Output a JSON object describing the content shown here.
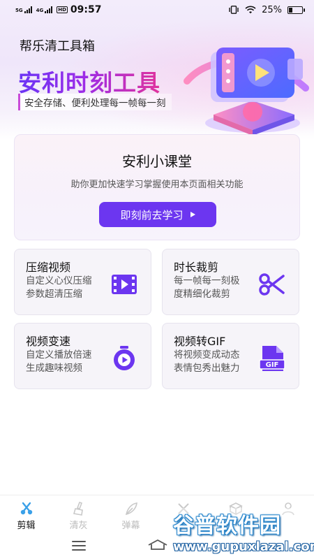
{
  "status_bar": {
    "signal1_label": "5G",
    "signal2_label": "4G",
    "hd_label": "HD",
    "time": "09:57",
    "battery": "25%",
    "battery_level": 0.25
  },
  "header": {
    "app_title": "帮乐清工具箱",
    "hero_title": "安利时刻工具",
    "hero_subtitle": "安全存储、便利处理每一帧每一刻"
  },
  "classroom": {
    "title": "安利小课堂",
    "description": "助你更加快速学习掌握使用本页面相关功能",
    "button_label": "即刻前去学习"
  },
  "tools": [
    {
      "name": "压缩视频",
      "description": "自定义心仪压缩 参数超清压缩",
      "icon": "film-play-icon"
    },
    {
      "name": "时长裁剪",
      "description": "每一帧每一刻极度精细化裁剪",
      "icon": "scissors-icon"
    },
    {
      "name": "视频变速",
      "description": "自定义播放倍速生成趣味视频",
      "icon": "stopwatch-play-icon"
    },
    {
      "name": "视频转GIF",
      "description": "将视频变成动态表情包秀出魅力",
      "icon": "gif-file-icon"
    }
  ],
  "bottom_nav": [
    {
      "label": "剪辑",
      "icon": "scissors-icon",
      "active": true
    },
    {
      "label": "清灰",
      "icon": "brush-icon",
      "active": false
    },
    {
      "label": "弹幕",
      "icon": "feather-icon",
      "active": false
    },
    {
      "label": "",
      "icon": "tools-icon",
      "active": false
    },
    {
      "label": "",
      "icon": "box-icon",
      "active": false
    },
    {
      "label": "",
      "icon": "user-icon",
      "active": false
    }
  ],
  "watermark": {
    "main": "谷普软件园",
    "url": "www.gupuxlazal.com"
  },
  "colors": {
    "accent": "#6c36f0",
    "hero_gradient_start": "#6a34f5",
    "hero_gradient_end": "#e0339c"
  }
}
